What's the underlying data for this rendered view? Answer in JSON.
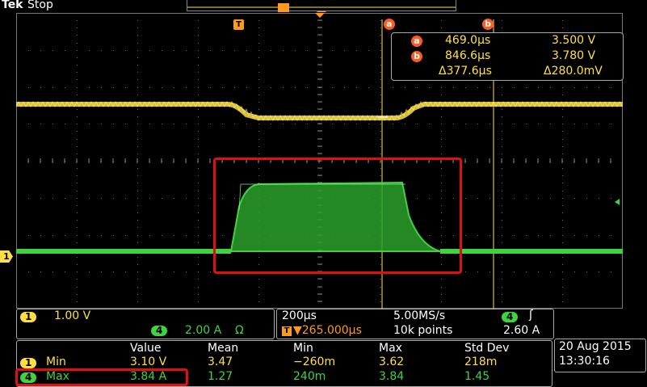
{
  "header": {
    "brand": "Tek",
    "status": "Stop"
  },
  "markers": {
    "trigger": "T",
    "cursor_a": "a",
    "cursor_b": "b"
  },
  "cursors": {
    "a": {
      "label": "a",
      "time": "469.0µs",
      "volt": "3.500 V"
    },
    "b": {
      "label": "b",
      "time": "846.6µs",
      "volt": "3.780 V"
    },
    "delta": {
      "time": "Δ377.6µs",
      "volt": "Δ280.0mV"
    }
  },
  "channels": {
    "ch1": {
      "tag": "1",
      "scale": "1.00 V",
      "color": "#ffe040"
    },
    "ch4": {
      "tag": "4",
      "scale": "2.00 A",
      "unit_sym": "Ω",
      "color": "#3fd33f"
    }
  },
  "left_marker": "1",
  "timebase": {
    "scale": "200µs",
    "rate": "5.00MS/s",
    "trig_pos": "▼265.000µs",
    "trig_tag": "T",
    "record": "10k points",
    "trig_src": "4",
    "trig_slope": "ʃ",
    "trig_level": "2.60 A"
  },
  "measurements": {
    "headers": [
      "Value",
      "Mean",
      "Min",
      "Max",
      "Std Dev"
    ],
    "rows": [
      {
        "tag": "1",
        "name": "Min",
        "value": "3.10 V",
        "mean": "3.47",
        "min": "−260m",
        "max": "3.62",
        "std": "218m",
        "color": "#ffe040"
      },
      {
        "tag": "4",
        "name": "Max",
        "value": "3.84 A",
        "mean": "1.27",
        "min": "240m",
        "max": "3.84",
        "std": "1.45",
        "color": "#3fd33f"
      }
    ]
  },
  "datetime": {
    "date": "20 Aug 2015",
    "time": "13:30:16"
  },
  "colors": {
    "ch1": "#ffe040",
    "ch4": "#3fd33f",
    "cursor": "#ffe040",
    "badge": "#ff5a1f",
    "highlight": "#e01010"
  }
}
